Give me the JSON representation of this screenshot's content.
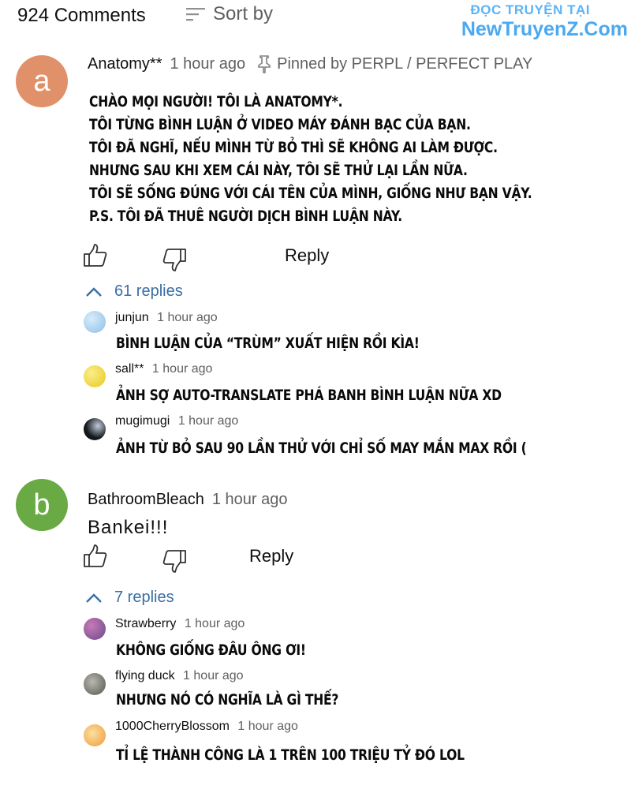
{
  "header": {
    "count": "924 Comments",
    "sort_label": "Sort by"
  },
  "watermark": {
    "line1": "ĐỌC TRUYỆN TẠI",
    "line2": "NewTruyenZ.Com"
  },
  "comments": [
    {
      "avatar_letter": "a",
      "avatar_color": "#e0916a",
      "author": "Anatomy**",
      "time": "1 hour ago",
      "pinned": "Pinned by PERPL / PERFECT PLAY",
      "lines": [
        "Chào mọi người! Tôi là Anatomy*.",
        "Tôi từng bình luận ở video máy đánh bạc của bạn.",
        "Tôi đã nghĩ, nếu mình từ bỏ thì sẽ không ai làm được.",
        "Nhưng sau khi xem cái này, tôi sẽ thử lại lần nữa.",
        "Tôi sẽ sống đúng với cái tên của mình, giống như bạn vậy.",
        "P.S. Tôi đã thuê người dịch bình luận này."
      ],
      "reply_label": "Reply",
      "replies_count": "61 replies",
      "replies": [
        {
          "author": "junjun",
          "time": "1 hour ago",
          "text": "Bình luận của “trùm” xuất hiện rồi kìa!",
          "avatar_color": "#9cc8ec"
        },
        {
          "author": "sall**",
          "time": "1 hour ago",
          "text": "Ảnh sợ auto-translate phá banh bình luận nữa xD",
          "avatar_color": "#f1dc4a"
        },
        {
          "author": "mugimugi",
          "time": "1 hour ago",
          "text": "Ảnh từ bỏ sau 90 lần thử với chỉ số may mắn max rồi (",
          "avatar_color": "#2a2d35"
        }
      ]
    },
    {
      "avatar_letter": "b",
      "avatar_color": "#6aaa44",
      "author": "BathroomBleach",
      "time": "1 hour ago",
      "text": "Bankei!!!",
      "reply_label": "Reply",
      "replies_count": "7 replies",
      "replies": [
        {
          "author": "Strawberry",
          "time": "1 hour ago",
          "text": "Không giống đâu ông ơi!",
          "avatar_color": "#9a5a8a"
        },
        {
          "author": "flying duck",
          "time": "1 hour ago",
          "text": "Nhưng nó có nghĩa là gì thế?",
          "avatar_color": "#7a7a72"
        },
        {
          "author": "1000CherryBlossom",
          "time": "1 hour ago",
          "text": "Tỉ lệ thành công là 1 trên 100 triệu tỷ đó lol",
          "avatar_color": "#f0b050"
        }
      ]
    }
  ]
}
